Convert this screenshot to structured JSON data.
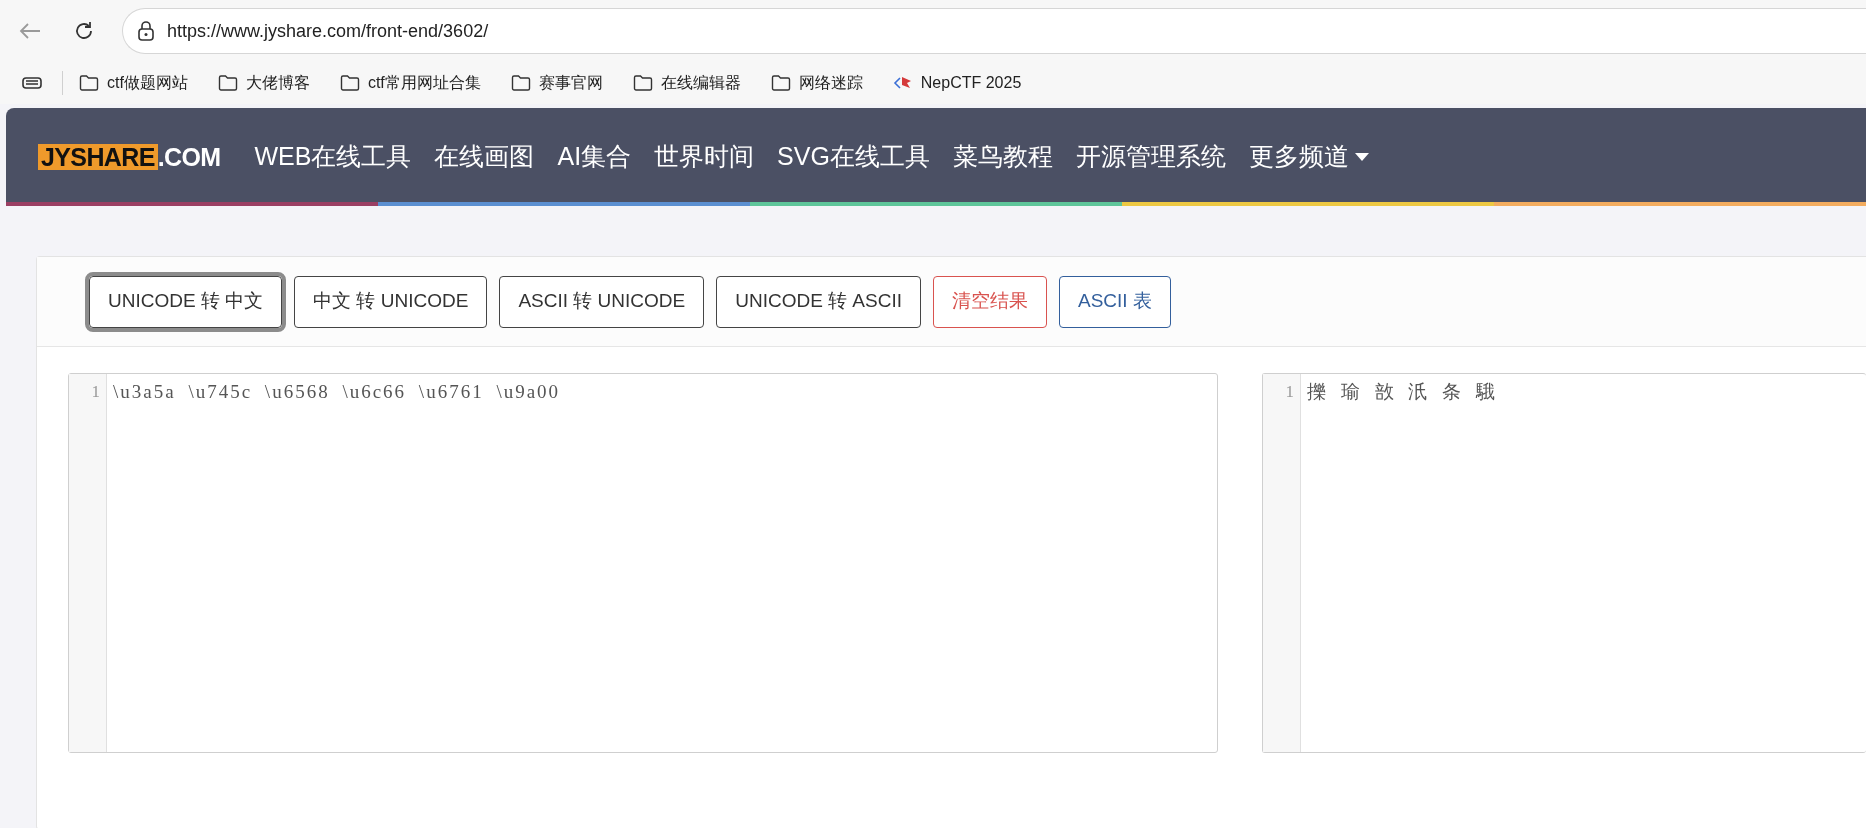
{
  "browser": {
    "url": "https://www.jyshare.com/front-end/3602/",
    "bookmarks": [
      {
        "label": "ctf做题网站",
        "kind": "folder"
      },
      {
        "label": "大佬博客",
        "kind": "folder"
      },
      {
        "label": "ctf常用网址合集",
        "kind": "folder"
      },
      {
        "label": "赛事官网",
        "kind": "folder"
      },
      {
        "label": "在线编辑器",
        "kind": "folder"
      },
      {
        "label": "网络迷踪",
        "kind": "folder"
      },
      {
        "label": "NepCTF 2025",
        "kind": "site"
      }
    ]
  },
  "nav": {
    "logo": {
      "main": "JYSHARE",
      "suffix": ".COM"
    },
    "items": [
      {
        "label": "WEB在线工具",
        "dropdown": false
      },
      {
        "label": "在线画图",
        "dropdown": false
      },
      {
        "label": "AI集合",
        "dropdown": false
      },
      {
        "label": "世界时间",
        "dropdown": false
      },
      {
        "label": "SVG在线工具",
        "dropdown": false
      },
      {
        "label": "菜鸟教程",
        "dropdown": false
      },
      {
        "label": "开源管理系统",
        "dropdown": false
      },
      {
        "label": "更多频道",
        "dropdown": true
      }
    ]
  },
  "buttons": [
    {
      "label": "UNICODE 转 中文",
      "kind": "default",
      "focused": true
    },
    {
      "label": "中文 转 UNICODE",
      "kind": "default",
      "focused": false
    },
    {
      "label": "ASCII 转 UNICODE",
      "kind": "default",
      "focused": false
    },
    {
      "label": "UNICODE 转 ASCII",
      "kind": "default",
      "focused": false
    },
    {
      "label": "清空结果",
      "kind": "danger",
      "focused": false
    },
    {
      "label": "ASCII 表",
      "kind": "info",
      "focused": false
    }
  ],
  "editors": [
    {
      "lines": [
        {
          "number": "1",
          "text": "\\u3a5a \\u745c \\u6568 \\u6c66 \\u6761 \\u9a00"
        }
      ]
    },
    {
      "lines": [
        {
          "number": "1",
          "text": "擽 瑜 敨 汦 条 騀"
        }
      ]
    }
  ]
}
